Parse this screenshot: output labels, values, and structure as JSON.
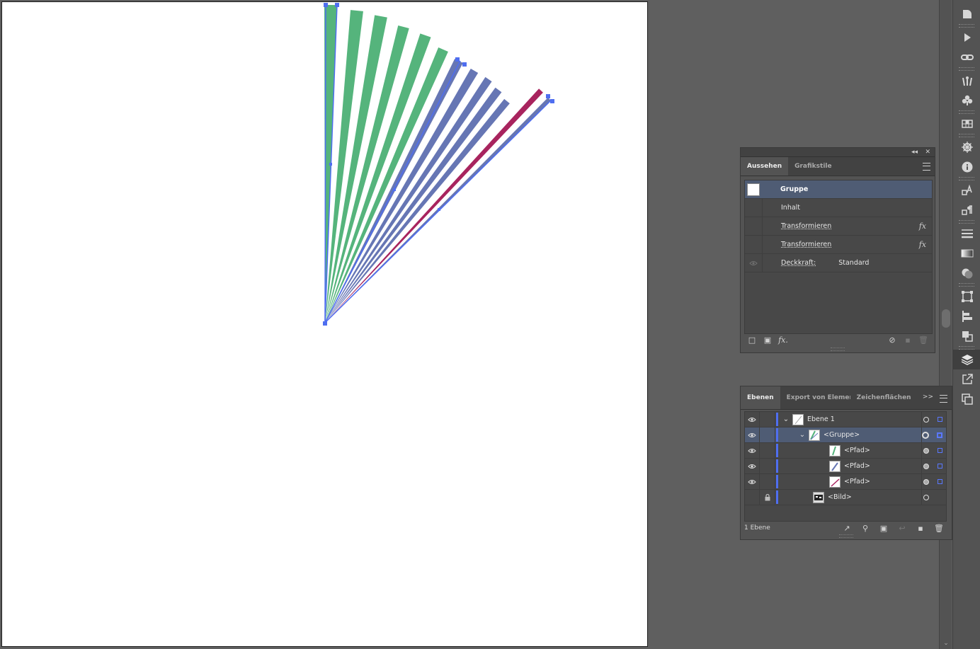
{
  "appearance_panel": {
    "tabs": [
      {
        "label": "Aussehen",
        "active": true
      },
      {
        "label": "Grafikstile",
        "active": false
      }
    ],
    "rows": [
      {
        "label": "Gruppe",
        "selected": true,
        "swatch": "#ffffff"
      },
      {
        "label": "Inhalt"
      },
      {
        "label": "Transformieren",
        "fx": "fx"
      },
      {
        "label": "Transformieren",
        "fx": "fx"
      },
      {
        "label": "Deckkraft:",
        "value": "Standard"
      }
    ],
    "footer_icons": [
      "new-stroke-icon",
      "new-fill-icon",
      "add-effect-icon",
      "clear-appearance-icon",
      "duplicate-item-icon",
      "delete-item-icon"
    ],
    "add_effect_label": "fx."
  },
  "layers_panel": {
    "tabs": [
      {
        "label": "Ebenen",
        "active": true
      },
      {
        "label": "Export von Elementen",
        "active": false
      },
      {
        "label": "Zeichenflächen",
        "active": false
      }
    ],
    "overflow_label": ">>",
    "rows": [
      {
        "name": "Ebene 1",
        "indent": 0,
        "expanded": true,
        "visible": true,
        "locked": false
      },
      {
        "name": "<Gruppe>",
        "indent": 1,
        "expanded": true,
        "visible": true,
        "selected": true
      },
      {
        "name": "<Pfad>",
        "indent": 2,
        "visible": true
      },
      {
        "name": "<Pfad>",
        "indent": 2,
        "visible": true
      },
      {
        "name": "<Pfad>",
        "indent": 2,
        "visible": true
      },
      {
        "name": "<Bild>",
        "indent": 1,
        "visible": false,
        "locked": true
      }
    ],
    "layer_count": "1 Ebene"
  },
  "artwork": {
    "colors": {
      "green": "#55b47c",
      "blue": "#6676b4",
      "magenta": "#a8245e",
      "selection": "#4f6ef0"
    }
  },
  "dock_icons": [
    "properties-icon",
    "actions-play-icon",
    "links-icon",
    "brushes-icon",
    "symbols-icon",
    "swatches-grid-icon",
    "navigator-icon",
    "info-icon",
    "character-styles-icon",
    "paragraph-styles-icon",
    "stroke-icon",
    "gradient-icon",
    "transparency-icon",
    "transform-icon",
    "align-icon",
    "pathfinder-icon",
    "layers-icon",
    "export-icon",
    "artboards-icon"
  ]
}
